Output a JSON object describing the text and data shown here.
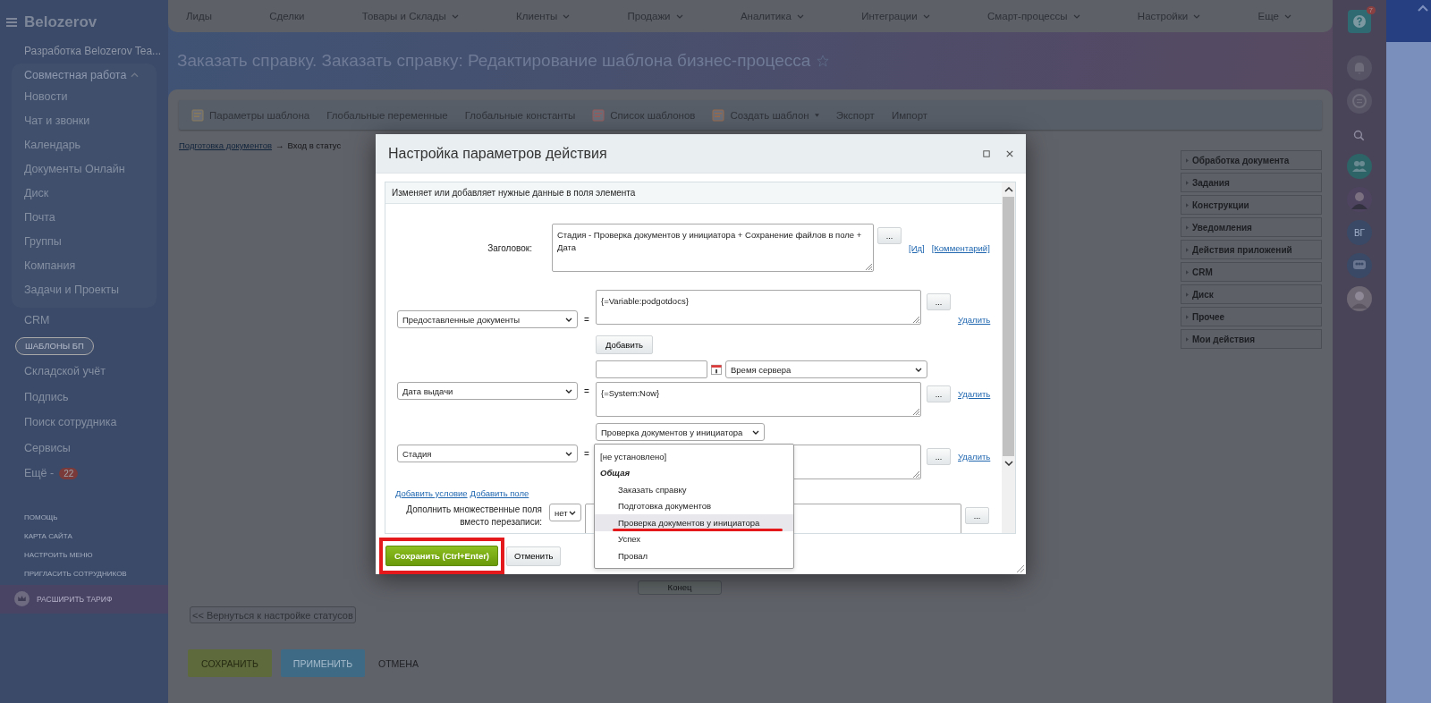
{
  "sidebar": {
    "logo": "Belozerov",
    "team": "Разработка Belozerov Tea...",
    "group": {
      "label": "Совместная работа",
      "expanded": true,
      "items": [
        "Новости",
        "Чат и звонки",
        "Календарь",
        "Документы Онлайн",
        "Диск",
        "Почта",
        "Группы",
        "Компания",
        "Задачи и Проекты"
      ]
    },
    "items": [
      {
        "label": "CRM",
        "selected": false
      },
      {
        "label": "ШАБЛОНЫ БП",
        "selected": true
      },
      {
        "label": "Складской учёт",
        "selected": false
      },
      {
        "label": "Подпись",
        "selected": false
      },
      {
        "label": "Поиск сотрудника",
        "selected": false
      },
      {
        "label": "Сервисы",
        "selected": false
      },
      {
        "label": "Ещё -",
        "selected": false,
        "badge": "22"
      }
    ],
    "footer_links": [
      "ПОМОЩЬ",
      "КАРТА САЙТА",
      "НАСТРОИТЬ МЕНЮ",
      "ПРИГЛАСИТЬ СОТРУДНИКОВ"
    ],
    "upgrade": "РАСШИРИТЬ ТАРИФ"
  },
  "top_menu": [
    {
      "label": "Лиды",
      "caret": false
    },
    {
      "label": "Сделки",
      "caret": false
    },
    {
      "label": "Товары и Склады",
      "caret": true
    },
    {
      "label": "Клиенты",
      "caret": true
    },
    {
      "label": "Продажи",
      "caret": true
    },
    {
      "label": "Аналитика",
      "caret": true
    },
    {
      "label": "Интеграции",
      "caret": true
    },
    {
      "label": "Смарт-процессы",
      "caret": true
    },
    {
      "label": "Настройки",
      "caret": true
    },
    {
      "label": "Еще",
      "caret": true
    }
  ],
  "page_title": "Заказать справку. Заказать справку: Редактирование шаблона бизнес-процесса",
  "toolbar": [
    {
      "label": "Параметры шаблона",
      "kind": "settings",
      "caret": false
    },
    {
      "label": "Глобальные переменные",
      "kind": "plain",
      "caret": false
    },
    {
      "label": "Глобальные константы",
      "kind": "plain",
      "caret": false
    },
    {
      "label": "Список шаблонов",
      "kind": "list",
      "caret": false
    },
    {
      "label": "Создать шаблон",
      "kind": "create",
      "caret": true
    },
    {
      "label": "Экспорт",
      "kind": "plain",
      "caret": false
    },
    {
      "label": "Импорт",
      "kind": "plain",
      "caret": false
    }
  ],
  "breadcrumb": {
    "link": "Подготовка документов",
    "separator": "→",
    "current": "Вход в статус"
  },
  "activity_groups": [
    "Обработка документа",
    "Задания",
    "Конструкции",
    "Уведомления",
    "Действия приложений",
    "CRM",
    "Диск",
    "Прочее",
    "Мои действия"
  ],
  "end_node": "Конец",
  "back_button": "<< Вернуться к настройке статусов",
  "footer_buttons": [
    {
      "label": "СОХРАНИТЬ",
      "kind": "save"
    },
    {
      "label": "ПРИМЕНИТЬ",
      "kind": "apply"
    },
    {
      "label": "ОТМЕНА",
      "kind": "cancel"
    }
  ],
  "right_rail": {
    "help_badge": "7",
    "initials": "ВГ"
  },
  "dialog": {
    "title": "Настройка параметров действия",
    "description": "Изменяет или добавляет нужные данные в поля элемента",
    "title_field": {
      "label": "Заголовок:",
      "value": "Стадия - Проверка документов у инициатора + Сохранение файлов в поле + Дата",
      "picker": "...",
      "links": [
        "[Ид]",
        "[Комментарий]"
      ]
    },
    "fields": [
      {
        "kind": "text",
        "field": "Предоставленные документы",
        "equals": "=",
        "value": "{=Variable:podgotdocs}",
        "picker": "...",
        "delete": "Удалить",
        "add_button": "Добавить"
      },
      {
        "kind": "date",
        "field": "Дата выдачи",
        "equals": "=",
        "timezone": "Время сервера",
        "value": "{=System:Now}",
        "picker": "...",
        "delete": "Удалить"
      },
      {
        "kind": "select",
        "field": "Стадия",
        "equals": "=",
        "selected_value": "Проверка документов у инициатора",
        "picker": "...",
        "delete": "Удалить"
      }
    ],
    "links": [
      "Добавить условие",
      "Добавить поле"
    ],
    "append": {
      "label": "Дополнить множественные поля вместо перезаписи:",
      "value": "нет",
      "picker": "..."
    },
    "dropdown": [
      {
        "label": "[не установлено]",
        "kind": "empty",
        "selected": false
      },
      {
        "label": "Общая",
        "kind": "group",
        "selected": false
      },
      {
        "label": "Заказать справку",
        "kind": "option",
        "selected": false
      },
      {
        "label": "Подготовка документов",
        "kind": "option",
        "selected": false
      },
      {
        "label": "Проверка документов у инициатора",
        "kind": "option",
        "selected": true
      },
      {
        "label": "Успех",
        "kind": "option",
        "selected": false
      },
      {
        "label": "Провал",
        "kind": "option",
        "selected": false
      }
    ],
    "save_button": "Сохранить (Ctrl+Enter)",
    "cancel_button": "Отменить"
  }
}
